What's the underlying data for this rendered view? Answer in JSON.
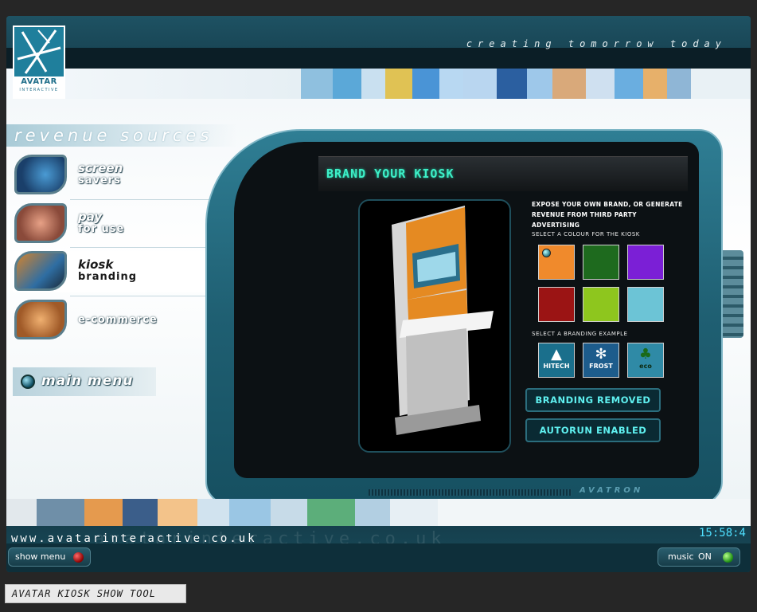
{
  "header": {
    "tagline": "creating tomorrow today",
    "logo_name": "AVATAR",
    "logo_sub": "INTERACTIVE"
  },
  "nav": {
    "heading": "revenue sources",
    "items": [
      {
        "line1": "screen",
        "line2": "savers",
        "active": false
      },
      {
        "line1": "pay",
        "line2": "for use",
        "active": false
      },
      {
        "line1": "kiosk",
        "line2": "branding",
        "active": true
      },
      {
        "line1": "",
        "line2": "e-commerce",
        "active": false
      }
    ],
    "main_menu": "main menu"
  },
  "panel": {
    "title": "BRAND YOUR KIOSK",
    "description": "EXPOSE YOUR OWN BRAND, OR GENERATE REVENUE FROM THIRD PARTY ADVERTISING",
    "colour_label": "SELECT A COLOUR FOR THE KIOSK",
    "colours": [
      {
        "name": "orange",
        "hex": "#f08a2c",
        "selected": true
      },
      {
        "name": "dark-green",
        "hex": "#1e6a1e",
        "selected": false
      },
      {
        "name": "purple",
        "hex": "#7b1fd6",
        "selected": false
      },
      {
        "name": "dark-red",
        "hex": "#9b1414",
        "selected": false
      },
      {
        "name": "lime-green",
        "hex": "#8ec61e",
        "selected": false
      },
      {
        "name": "light-blue",
        "hex": "#6cc4d6",
        "selected": false
      }
    ],
    "branding_label": "SELECT A BRANDING EXAMPLE",
    "brands": [
      {
        "name": "HITECH",
        "icon": "chevron-up-icon"
      },
      {
        "name": "FROST",
        "icon": "snowflake-icon"
      },
      {
        "name": "eco",
        "icon": "leaf-icon"
      }
    ],
    "branding_button": "BRANDING REMOVED",
    "autorun_button": "AUTORUN ENABLED",
    "footer_brand": "AVATRON"
  },
  "footer": {
    "url": "www.avatarinteractive.co.uk",
    "url_ghost": "avatarinteractive.co.uk",
    "clock": "15:58:4",
    "show_menu": "show menu",
    "music_label": "music",
    "music_state": "ON"
  },
  "caption": "AVATAR KIOSK SHOW TOOL"
}
